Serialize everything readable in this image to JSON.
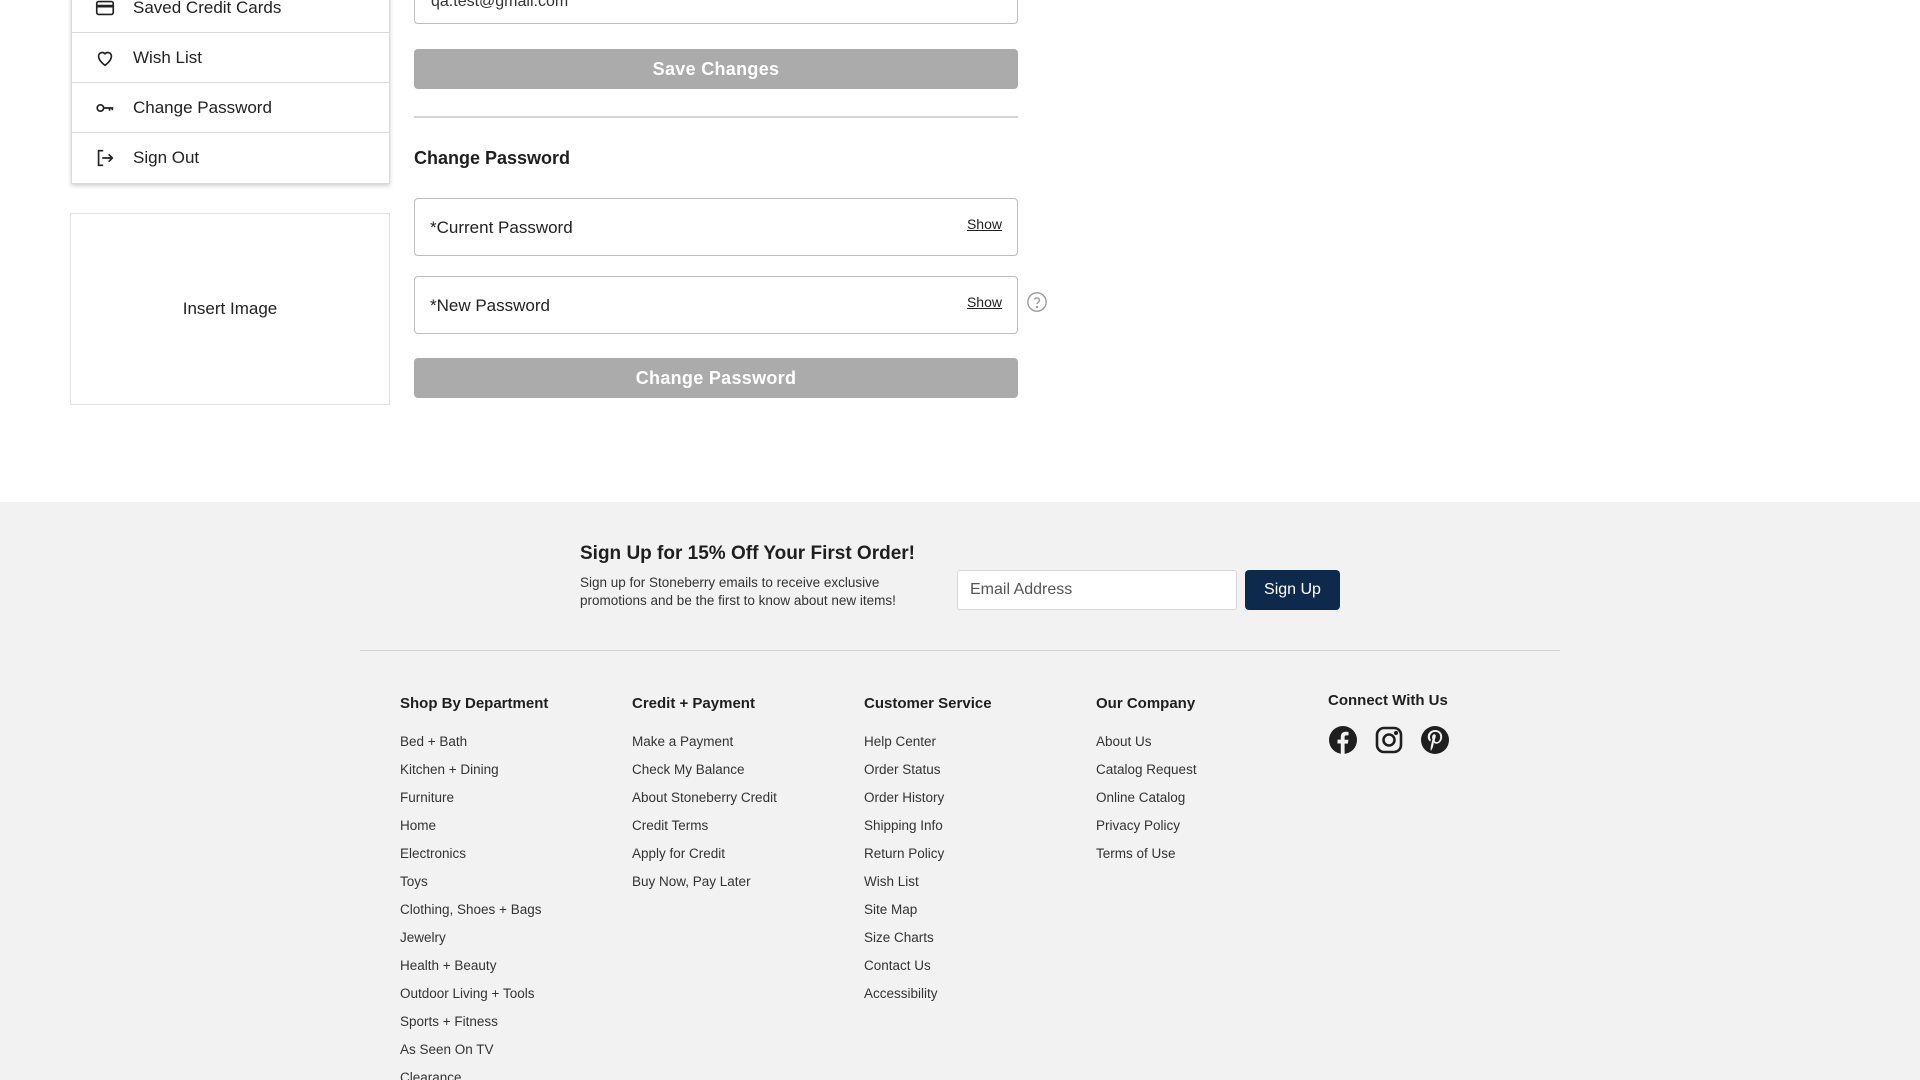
{
  "sidebar": {
    "items": [
      {
        "label": "Saved Credit Cards",
        "icon": "credit-card-icon"
      },
      {
        "label": "Wish List",
        "icon": "heart-icon"
      },
      {
        "label": "Change Password",
        "icon": "key-icon"
      },
      {
        "label": "Sign Out",
        "icon": "sign-out-icon"
      }
    ],
    "insert_image_label": "Insert Image"
  },
  "account_form": {
    "email_value_partial": "qa.test@gmail.com",
    "save_button_label": "Save Changes"
  },
  "change_password": {
    "title": "Change Password",
    "current_password_placeholder": "*Current Password",
    "new_password_placeholder": "*New Password",
    "show_label": "Show",
    "submit_label": "Change Password"
  },
  "footer": {
    "signup": {
      "title": "Sign Up for 15% Off Your First Order!",
      "text": "Sign up for Stoneberry emails to receive exclusive promotions and be the first to know about new items!",
      "email_placeholder": "Email Address",
      "button_label": "Sign Up"
    },
    "columns": [
      {
        "heading": "Shop By Department",
        "links": [
          "Bed + Bath",
          "Kitchen + Dining",
          "Furniture",
          "Home",
          "Electronics",
          "Toys",
          "Clothing, Shoes + Bags",
          "Jewelry",
          "Health + Beauty",
          "Outdoor Living + Tools",
          "Sports + Fitness",
          "As Seen On TV",
          "Clearance"
        ]
      },
      {
        "heading": "Credit + Payment",
        "links": [
          "Make a Payment",
          "Check My Balance",
          "About Stoneberry Credit",
          "Credit Terms",
          "Apply for Credit",
          "Buy Now, Pay Later"
        ]
      },
      {
        "heading": "Customer Service",
        "links": [
          "Help Center",
          "Order Status",
          "Order History",
          "Shipping Info",
          "Return Policy",
          "Wish List",
          "Site Map",
          "Size Charts",
          "Contact Us",
          "Accessibility"
        ]
      },
      {
        "heading": "Our Company",
        "links": [
          "About Us",
          "Catalog Request",
          "Online Catalog",
          "Privacy Policy",
          "Terms of Use"
        ]
      }
    ],
    "connect": {
      "heading": "Connect With Us",
      "icons": [
        "facebook-icon",
        "instagram-icon",
        "pinterest-icon"
      ]
    }
  },
  "colors": {
    "disabled_button": "#ababab",
    "signup_button": "#0d2a4d",
    "footer_background": "#f2f2f2"
  }
}
